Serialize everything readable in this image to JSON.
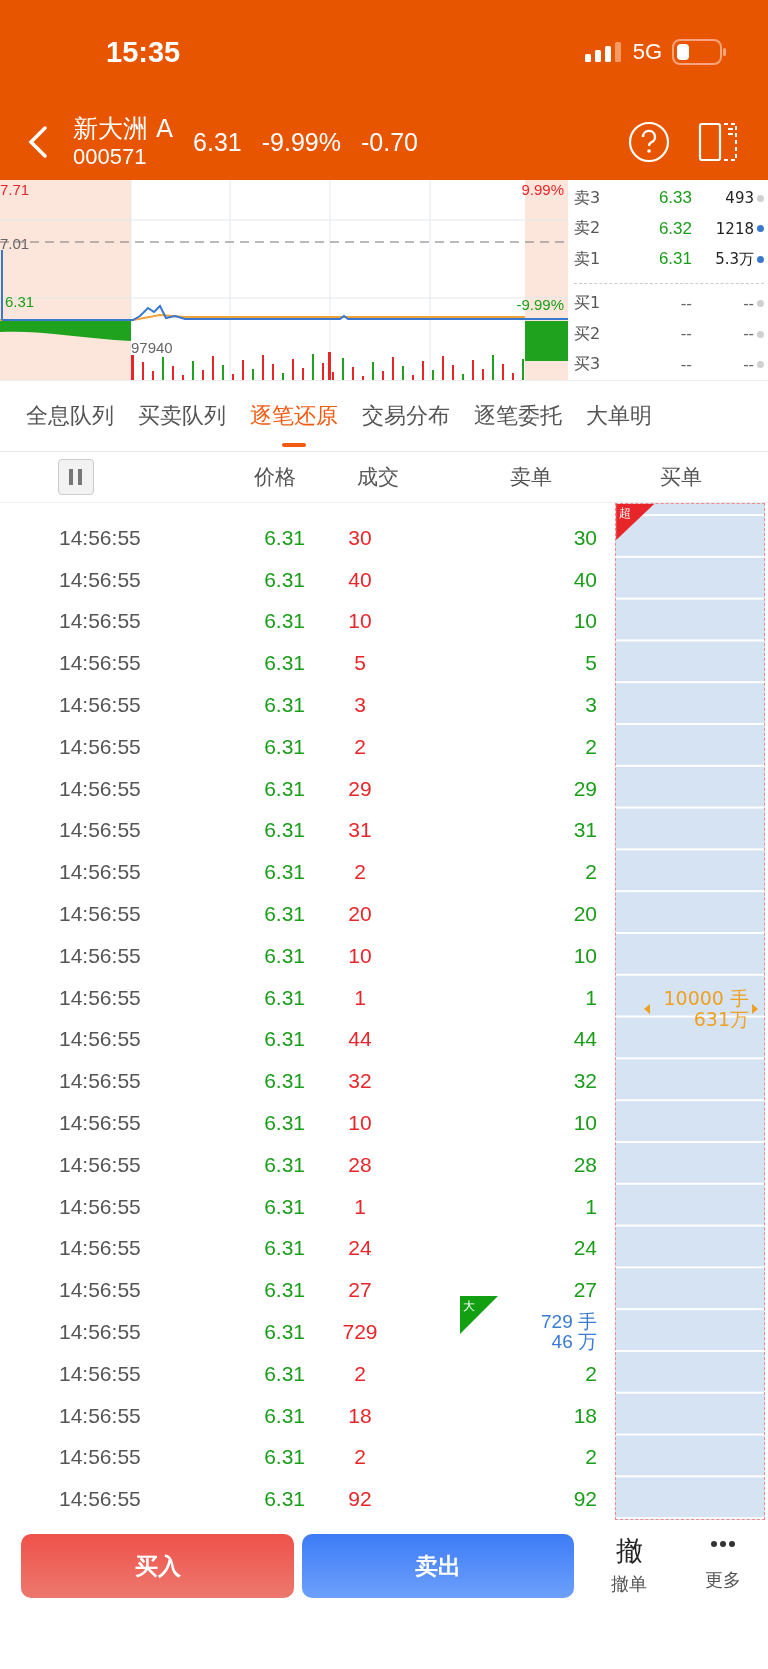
{
  "status_bar": {
    "time": "15:35",
    "network": "5G"
  },
  "header": {
    "name": "新大洲 A",
    "code": "000571",
    "price": "6.31",
    "change_pct": "-9.99%",
    "change": "-0.70"
  },
  "chart": {
    "high_price": "7.71",
    "base_price": "7.01",
    "low_price": "6.31",
    "high_pct": "9.99%",
    "low_pct": "-9.99%",
    "volume": "97940"
  },
  "order_book": [
    {
      "label": "卖3",
      "price": "6.33",
      "volume": "493",
      "color": "#d0d0d0"
    },
    {
      "label": "卖2",
      "price": "6.32",
      "volume": "1218",
      "color": "#3a78d0"
    },
    {
      "label": "卖1",
      "price": "6.31",
      "volume": "5.3万",
      "color": "#3a78d0"
    },
    {
      "label": "买1",
      "price": "--",
      "volume": "--",
      "color": "#d0d0d0"
    },
    {
      "label": "买2",
      "price": "--",
      "volume": "--",
      "color": "#d0d0d0"
    },
    {
      "label": "买3",
      "price": "--",
      "volume": "--",
      "color": "#d0d0d0"
    }
  ],
  "tabs": [
    {
      "label": "全息队列",
      "selected": false
    },
    {
      "label": "买卖队列",
      "selected": false
    },
    {
      "label": "逐笔还原",
      "selected": true
    },
    {
      "label": "交易分布",
      "selected": false
    },
    {
      "label": "逐笔委托",
      "selected": false
    },
    {
      "label": "大单明",
      "selected": false
    }
  ],
  "columns": [
    "价格",
    "成交",
    "卖单",
    "买单"
  ],
  "rows": [
    {
      "time": "14:56:55",
      "price": "6.31",
      "volume": "30",
      "sell": "30"
    },
    {
      "time": "14:56:55",
      "price": "6.31",
      "volume": "40",
      "sell": "40"
    },
    {
      "time": "14:56:55",
      "price": "6.31",
      "volume": "10",
      "sell": "10"
    },
    {
      "time": "14:56:55",
      "price": "6.31",
      "volume": "5",
      "sell": "5"
    },
    {
      "time": "14:56:55",
      "price": "6.31",
      "volume": "3",
      "sell": "3"
    },
    {
      "time": "14:56:55",
      "price": "6.31",
      "volume": "2",
      "sell": "2"
    },
    {
      "time": "14:56:55",
      "price": "6.31",
      "volume": "29",
      "sell": "29"
    },
    {
      "time": "14:56:55",
      "price": "6.31",
      "volume": "31",
      "sell": "31"
    },
    {
      "time": "14:56:55",
      "price": "6.31",
      "volume": "2",
      "sell": "2"
    },
    {
      "time": "14:56:55",
      "price": "6.31",
      "volume": "20",
      "sell": "20"
    },
    {
      "time": "14:56:55",
      "price": "6.31",
      "volume": "10",
      "sell": "10"
    },
    {
      "time": "14:56:55",
      "price": "6.31",
      "volume": "1",
      "sell": "1"
    },
    {
      "time": "14:56:55",
      "price": "6.31",
      "volume": "44",
      "sell": "44"
    },
    {
      "time": "14:56:55",
      "price": "6.31",
      "volume": "32",
      "sell": "32"
    },
    {
      "time": "14:56:55",
      "price": "6.31",
      "volume": "10",
      "sell": "10"
    },
    {
      "time": "14:56:55",
      "price": "6.31",
      "volume": "28",
      "sell": "28"
    },
    {
      "time": "14:56:55",
      "price": "6.31",
      "volume": "1",
      "sell": "1"
    },
    {
      "time": "14:56:55",
      "price": "6.31",
      "volume": "24",
      "sell": "24"
    },
    {
      "time": "14:56:55",
      "price": "6.31",
      "volume": "27",
      "sell": "27"
    },
    {
      "time": "14:56:55",
      "price": "6.31",
      "volume": "729",
      "kind": "big",
      "badge": "大",
      "sell_lines": [
        "729 手",
        "46 万"
      ]
    },
    {
      "time": "14:56:55",
      "price": "6.31",
      "volume": "2",
      "sell": "2"
    },
    {
      "time": "14:56:55",
      "price": "6.31",
      "volume": "18",
      "sell": "18"
    },
    {
      "time": "14:56:55",
      "price": "6.31",
      "volume": "2",
      "sell": "2"
    },
    {
      "time": "14:56:55",
      "price": "6.31",
      "volume": "92",
      "sell": "92"
    }
  ],
  "buy_order": {
    "badge": "超",
    "lines": [
      "10000 手",
      "631万"
    ]
  },
  "actions": {
    "buy": "买入",
    "sell": "卖出",
    "cancel_icon": "撤",
    "cancel": "撤单",
    "more": "更多"
  }
}
